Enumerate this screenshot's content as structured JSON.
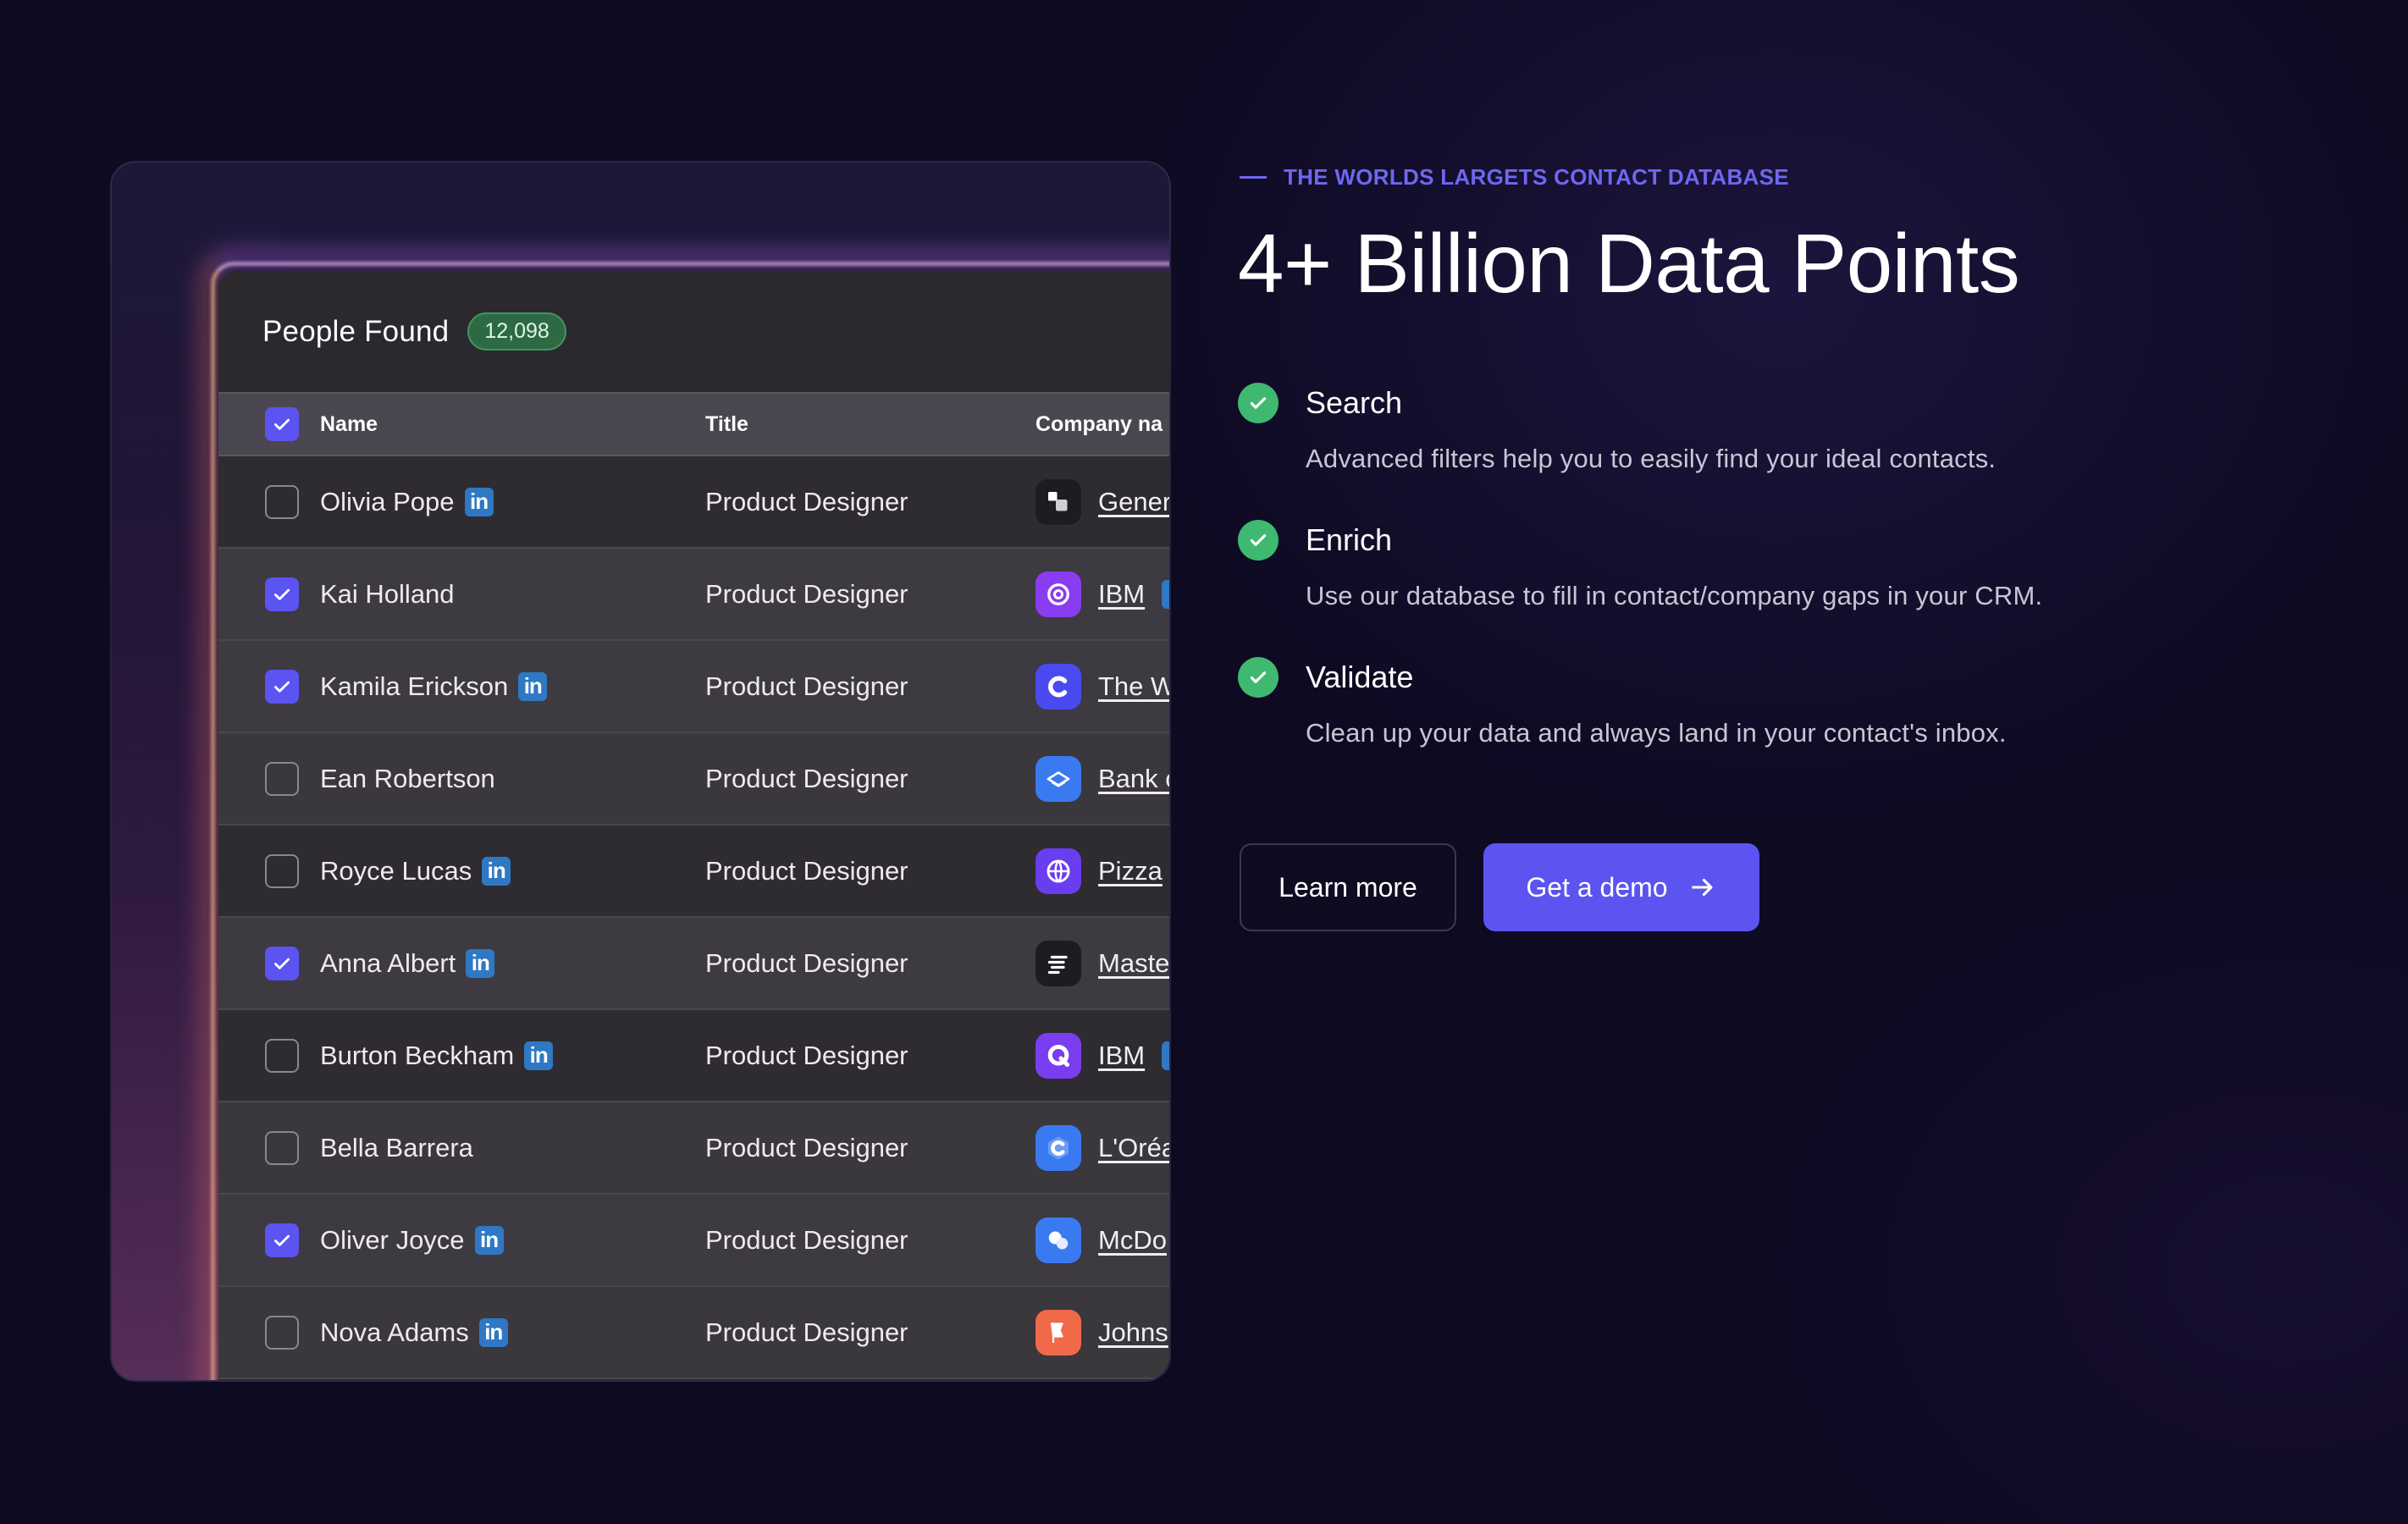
{
  "table": {
    "title": "People Found",
    "count": "12,098",
    "columns": {
      "name": "Name",
      "title": "Title",
      "company": "Company na"
    },
    "rows": [
      {
        "checked": false,
        "name": "Olivia Pope",
        "linkedin": true,
        "title": "Product Designer",
        "company": "Gener",
        "company_linkedin": false,
        "logo": "square-blocks-icon",
        "logo_color": "#1e1c22"
      },
      {
        "checked": true,
        "name": "Kai Holland",
        "linkedin": false,
        "title": "Product Designer",
        "company": "IBM",
        "company_linkedin": true,
        "logo": "ring-icon",
        "logo_color": "#8a3df0"
      },
      {
        "checked": true,
        "name": "Kamila Erickson",
        "linkedin": true,
        "title": "Product Designer",
        "company": "The W",
        "company_linkedin": false,
        "logo": "c-letter-icon",
        "logo_color": "#4a4af0"
      },
      {
        "checked": false,
        "name": "Ean Robertson",
        "linkedin": false,
        "title": "Product Designer",
        "company": "Bank o",
        "company_linkedin": false,
        "logo": "layers-icon",
        "logo_color": "#3a7af0"
      },
      {
        "checked": false,
        "name": "Royce Lucas",
        "linkedin": true,
        "title": "Product Designer",
        "company": "Pizza",
        "company_linkedin": false,
        "logo": "globe-icon",
        "logo_color": "#6a3df0"
      },
      {
        "checked": true,
        "name": "Anna Albert",
        "linkedin": true,
        "title": "Product Designer",
        "company": "Maste",
        "company_linkedin": false,
        "logo": "stripes-icon",
        "logo_color": "#1e1c22"
      },
      {
        "checked": false,
        "name": "Burton Beckham",
        "linkedin": true,
        "title": "Product Designer",
        "company": "IBM",
        "company_linkedin": true,
        "logo": "q-letter-icon",
        "logo_color": "#7a3df0"
      },
      {
        "checked": false,
        "name": "Bella Barrera",
        "linkedin": false,
        "title": "Product Designer",
        "company": "L'Oréa",
        "company_linkedin": false,
        "logo": "hexagon-c-icon",
        "logo_color": "#3a7af0"
      },
      {
        "checked": true,
        "name": "Oliver Joyce",
        "linkedin": true,
        "title": "Product Designer",
        "company": "McDo",
        "company_linkedin": false,
        "logo": "bubbles-icon",
        "logo_color": "#3a7af0"
      },
      {
        "checked": false,
        "name": "Nova Adams",
        "linkedin": true,
        "title": "Product Designer",
        "company": "Johns",
        "company_linkedin": false,
        "logo": "flag-icon",
        "logo_color": "#f06a4a"
      }
    ]
  },
  "hero": {
    "eyebrow": "THE WORLDS LARGETS CONTACT DATABASE",
    "headline": "4+ Billion Data Points",
    "features": [
      {
        "title": "Search",
        "description": "Advanced filters help you to easily find your ideal contacts."
      },
      {
        "title": "Enrich",
        "description": "Use our database to fill in contact/company gaps in your CRM."
      },
      {
        "title": "Validate",
        "description": "Clean up your data and always land in your contact's inbox."
      }
    ],
    "buttons": {
      "learn_more": "Learn more",
      "demo": "Get a demo"
    }
  },
  "colors": {
    "accent": "#5b54f0",
    "eyebrow": "#6f67f0",
    "success": "#3fb870",
    "badge": "#2d6a44",
    "linkedin": "#2f78c4",
    "background": "#0e0a22"
  }
}
